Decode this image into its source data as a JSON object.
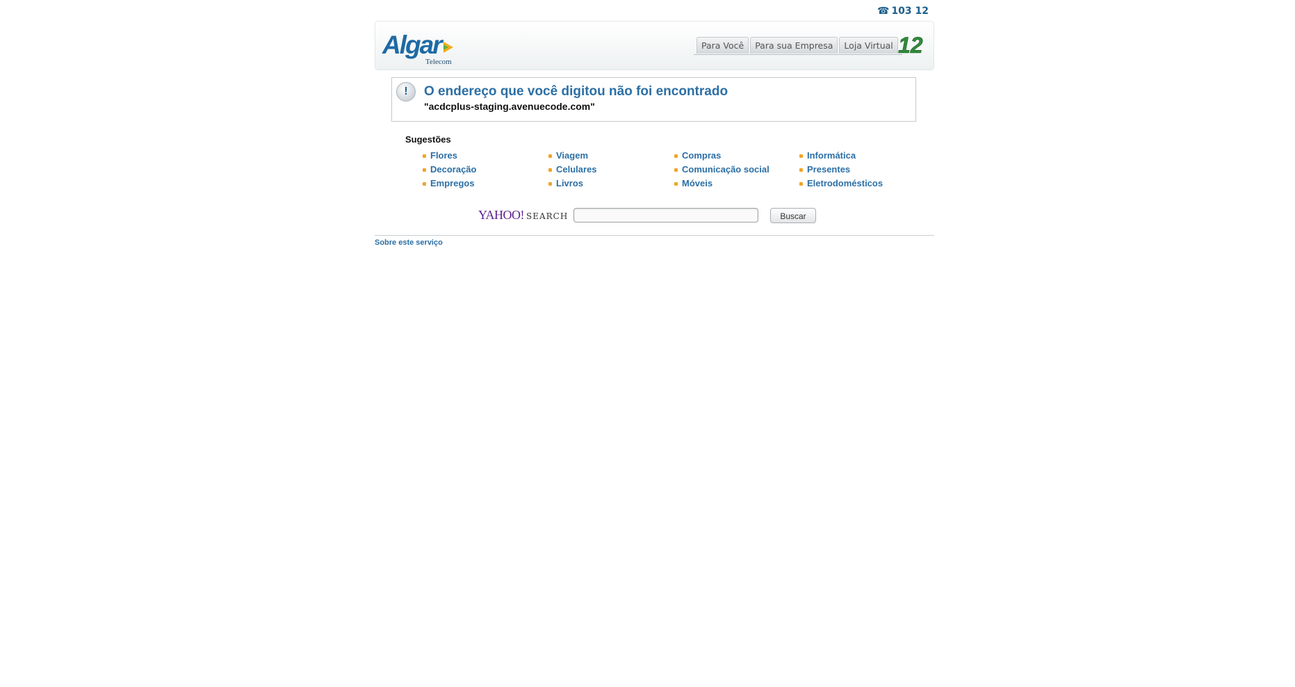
{
  "topbar": {
    "phone_icon": "phone-icon",
    "phone_number": "103 12"
  },
  "header": {
    "logo_text": "Algar",
    "logo_sub": "Telecom",
    "tabs": [
      {
        "label": "Para Você"
      },
      {
        "label": "Para sua Empresa"
      },
      {
        "label": "Loja Virtual"
      }
    ],
    "badge_text": "12"
  },
  "notice": {
    "icon": "alert-icon",
    "title": "O endereço que você digitou não foi encontrado",
    "url": "\"acdcplus-staging.avenuecode.com\""
  },
  "suggestions": {
    "title": "Sugestões",
    "columns": [
      [
        "Flores",
        "Decoração",
        "Empregos"
      ],
      [
        "Viagem",
        "Celulares",
        "Livros"
      ],
      [
        "Compras",
        "Comunicação social",
        "Móveis"
      ],
      [
        "Informática",
        "Presentes",
        "Eletrodomésticos"
      ]
    ]
  },
  "search": {
    "provider_logo": "YAHOO!",
    "provider_label": "SEARCH",
    "input_value": "",
    "input_placeholder": "",
    "button_label": "Buscar"
  },
  "footer": {
    "link": "Sobre este serviço"
  },
  "colors": {
    "link": "#2c6fa5",
    "bullet": "#f0a528",
    "brand_blue": "#1e6aa5",
    "yahoo_purple": "#5b1f8e"
  }
}
